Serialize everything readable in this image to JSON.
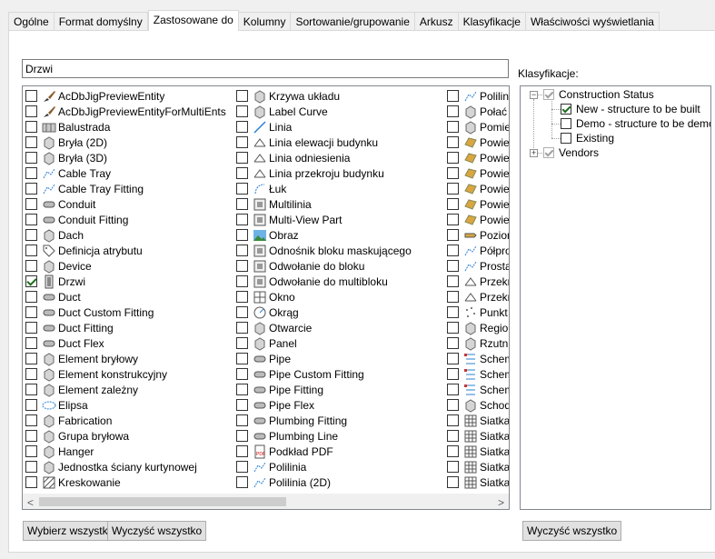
{
  "tabs": [
    {
      "label": "Ogólne"
    },
    {
      "label": "Format domyślny"
    },
    {
      "label": "Zastosowane do",
      "active": true
    },
    {
      "label": "Kolumny"
    },
    {
      "label": "Sortowanie/grupowanie"
    },
    {
      "label": "Arkusz"
    },
    {
      "label": "Klasyfikacje"
    },
    {
      "label": "Właściwości wyświetlania"
    }
  ],
  "search": {
    "value": "Drzwi"
  },
  "classifications_label": "Klasyfikacje:",
  "columns": [
    [
      {
        "label": "AcDbJigPreviewEntity",
        "icon": "brush-icon",
        "checked": false
      },
      {
        "label": "AcDbJigPreviewEntityForMultiEnts",
        "icon": "brush-icon",
        "checked": false
      },
      {
        "label": "Balustrada",
        "icon": "railing-icon",
        "checked": false
      },
      {
        "label": "Bryła (2D)",
        "icon": "mass-2d-icon",
        "checked": false
      },
      {
        "label": "Bryła (3D)",
        "icon": "mass-3d-icon",
        "checked": false
      },
      {
        "label": "Cable Tray",
        "icon": "cable-tray-icon",
        "checked": false
      },
      {
        "label": "Cable Tray Fitting",
        "icon": "cable-tray-fitting-icon",
        "checked": false
      },
      {
        "label": "Conduit",
        "icon": "conduit-icon",
        "checked": false
      },
      {
        "label": "Conduit Fitting",
        "icon": "conduit-fitting-icon",
        "checked": false
      },
      {
        "label": "Dach",
        "icon": "roof-icon",
        "checked": false
      },
      {
        "label": "Definicja atrybutu",
        "icon": "tag-icon",
        "checked": false
      },
      {
        "label": "Device",
        "icon": "device-icon",
        "checked": false
      },
      {
        "label": "Drzwi",
        "icon": "door-icon",
        "checked": true
      },
      {
        "label": "Duct",
        "icon": "duct-icon",
        "checked": false
      },
      {
        "label": "Duct Custom Fitting",
        "icon": "duct-custom-fitting-icon",
        "checked": false
      },
      {
        "label": "Duct Fitting",
        "icon": "duct-fitting-icon",
        "checked": false
      },
      {
        "label": "Duct Flex",
        "icon": "duct-flex-icon",
        "checked": false
      },
      {
        "label": "Element bryłowy",
        "icon": "mass-element-icon",
        "checked": false
      },
      {
        "label": "Element konstrukcyjny",
        "icon": "structural-member-icon",
        "checked": false
      },
      {
        "label": "Element zależny",
        "icon": "dependent-element-icon",
        "checked": false
      },
      {
        "label": "Elipsa",
        "icon": "ellipse-icon",
        "checked": false
      },
      {
        "label": "Fabrication",
        "icon": "fabrication-icon",
        "checked": false
      },
      {
        "label": "Grupa bryłowa",
        "icon": "mass-group-icon",
        "checked": false
      },
      {
        "label": "Hanger",
        "icon": "hanger-icon",
        "checked": false
      },
      {
        "label": "Jednostka ściany kurtynowej",
        "icon": "curtain-wall-unit-icon",
        "checked": false
      },
      {
        "label": "Kreskowanie",
        "icon": "hatch-icon",
        "checked": false
      }
    ],
    [
      {
        "label": "Krzywa układu",
        "icon": "layout-curve-icon",
        "checked": false
      },
      {
        "label": "Label Curve",
        "icon": "label-curve-icon",
        "checked": false
      },
      {
        "label": "Linia",
        "icon": "line-icon",
        "checked": false
      },
      {
        "label": "Linia elewacji budynku",
        "icon": "elevation-line-icon",
        "checked": false
      },
      {
        "label": "Linia odniesienia",
        "icon": "leader-icon",
        "checked": false
      },
      {
        "label": "Linia przekroju budynku",
        "icon": "section-line-icon",
        "checked": false
      },
      {
        "label": "Łuk",
        "icon": "arc-icon",
        "checked": false
      },
      {
        "label": "Multilinia",
        "icon": "multiline-icon",
        "checked": false
      },
      {
        "label": "Multi-View Part",
        "icon": "multi-view-part-icon",
        "checked": false
      },
      {
        "label": "Obraz",
        "icon": "image-icon",
        "checked": false
      },
      {
        "label": "Odnośnik bloku maskującego",
        "icon": "mask-block-ref-icon",
        "checked": false
      },
      {
        "label": "Odwołanie do bloku",
        "icon": "block-ref-icon",
        "checked": false
      },
      {
        "label": "Odwołanie do multibloku",
        "icon": "multi-block-ref-icon",
        "checked": false
      },
      {
        "label": "Okno",
        "icon": "window-icon",
        "checked": false
      },
      {
        "label": "Okrąg",
        "icon": "circle-icon",
        "checked": false
      },
      {
        "label": "Otwarcie",
        "icon": "opening-icon",
        "checked": false
      },
      {
        "label": "Panel",
        "icon": "panel-icon",
        "checked": false
      },
      {
        "label": "Pipe",
        "icon": "pipe-icon",
        "checked": false
      },
      {
        "label": "Pipe Custom Fitting",
        "icon": "pipe-custom-fitting-icon",
        "checked": false
      },
      {
        "label": "Pipe Fitting",
        "icon": "pipe-fitting-icon",
        "checked": false
      },
      {
        "label": "Pipe Flex",
        "icon": "pipe-flex-icon",
        "checked": false
      },
      {
        "label": "Plumbing Fitting",
        "icon": "plumbing-fitting-icon",
        "checked": false
      },
      {
        "label": "Plumbing Line",
        "icon": "plumbing-line-icon",
        "checked": false
      },
      {
        "label": "Podkład PDF",
        "icon": "pdf-icon",
        "checked": false
      },
      {
        "label": "Polilinia",
        "icon": "polyline-icon",
        "checked": false
      },
      {
        "label": "Polilinia (2D)",
        "icon": "polyline-2d-icon",
        "checked": false
      }
    ],
    [
      {
        "label": "Polilinia",
        "icon": "polyline-3d-icon",
        "checked": false
      },
      {
        "label": "Połać",
        "icon": "roof-slab-icon",
        "checked": false
      },
      {
        "label": "Pomieszczenie",
        "icon": "space-icon",
        "checked": false
      },
      {
        "label": "Powierzchnia",
        "icon": "surface-icon",
        "checked": false
      },
      {
        "label": "Powierzchnia",
        "icon": "surface-2-icon",
        "checked": false
      },
      {
        "label": "Powierzchnia",
        "icon": "surface-3-icon",
        "checked": false
      },
      {
        "label": "Powierzchnia",
        "icon": "surface-4-icon",
        "checked": false
      },
      {
        "label": "Powierzchnia",
        "icon": "surface-5-icon",
        "checked": false
      },
      {
        "label": "Powierzchnia",
        "icon": "surface-6-icon",
        "checked": false
      },
      {
        "label": "Poziom",
        "icon": "level-icon",
        "checked": false
      },
      {
        "label": "Półprosta",
        "icon": "ray-icon",
        "checked": false
      },
      {
        "label": "Prosta",
        "icon": "xline-icon",
        "checked": false
      },
      {
        "label": "Przekrój",
        "icon": "section-icon",
        "checked": false
      },
      {
        "label": "Przekrój",
        "icon": "section-2-icon",
        "checked": false
      },
      {
        "label": "Punkt",
        "icon": "point-icon",
        "checked": false
      },
      {
        "label": "Region",
        "icon": "region-icon",
        "checked": false
      },
      {
        "label": "Rzutnia",
        "icon": "viewport-icon",
        "checked": false
      },
      {
        "label": "Schemat",
        "icon": "schematic-icon",
        "checked": false
      },
      {
        "label": "Schemat",
        "icon": "schematic-line-icon",
        "checked": false
      },
      {
        "label": "Schemat",
        "icon": "schematic-symbol-icon",
        "checked": false
      },
      {
        "label": "Schody",
        "icon": "stair-icon",
        "checked": false
      },
      {
        "label": "Siatka",
        "icon": "grid-icon",
        "checked": false
      },
      {
        "label": "Siatka",
        "icon": "grid-2-icon",
        "checked": false
      },
      {
        "label": "Siatka",
        "icon": "grid-3-icon",
        "checked": false
      },
      {
        "label": "Siatka",
        "icon": "grid-4-icon",
        "checked": false
      },
      {
        "label": "Siatka",
        "icon": "grid-5-icon",
        "checked": false
      }
    ]
  ],
  "tree": {
    "root1": {
      "label": "Construction Status",
      "checked": true,
      "expander": "−"
    },
    "children": [
      {
        "label": "New - structure to be built",
        "checked": true
      },
      {
        "label": "Demo - structure to be demolished",
        "checked": false
      },
      {
        "label": "Existing",
        "checked": false
      }
    ],
    "root2": {
      "label": "Vendors",
      "checked": true,
      "expander": "+"
    }
  },
  "buttons": {
    "select_all": "Wybierz wszystko",
    "clear_all": "Wyczyść wszystko",
    "clear_all_right": "Wyczyść wszystko"
  },
  "scroll": {
    "left": "<",
    "right": ">"
  }
}
